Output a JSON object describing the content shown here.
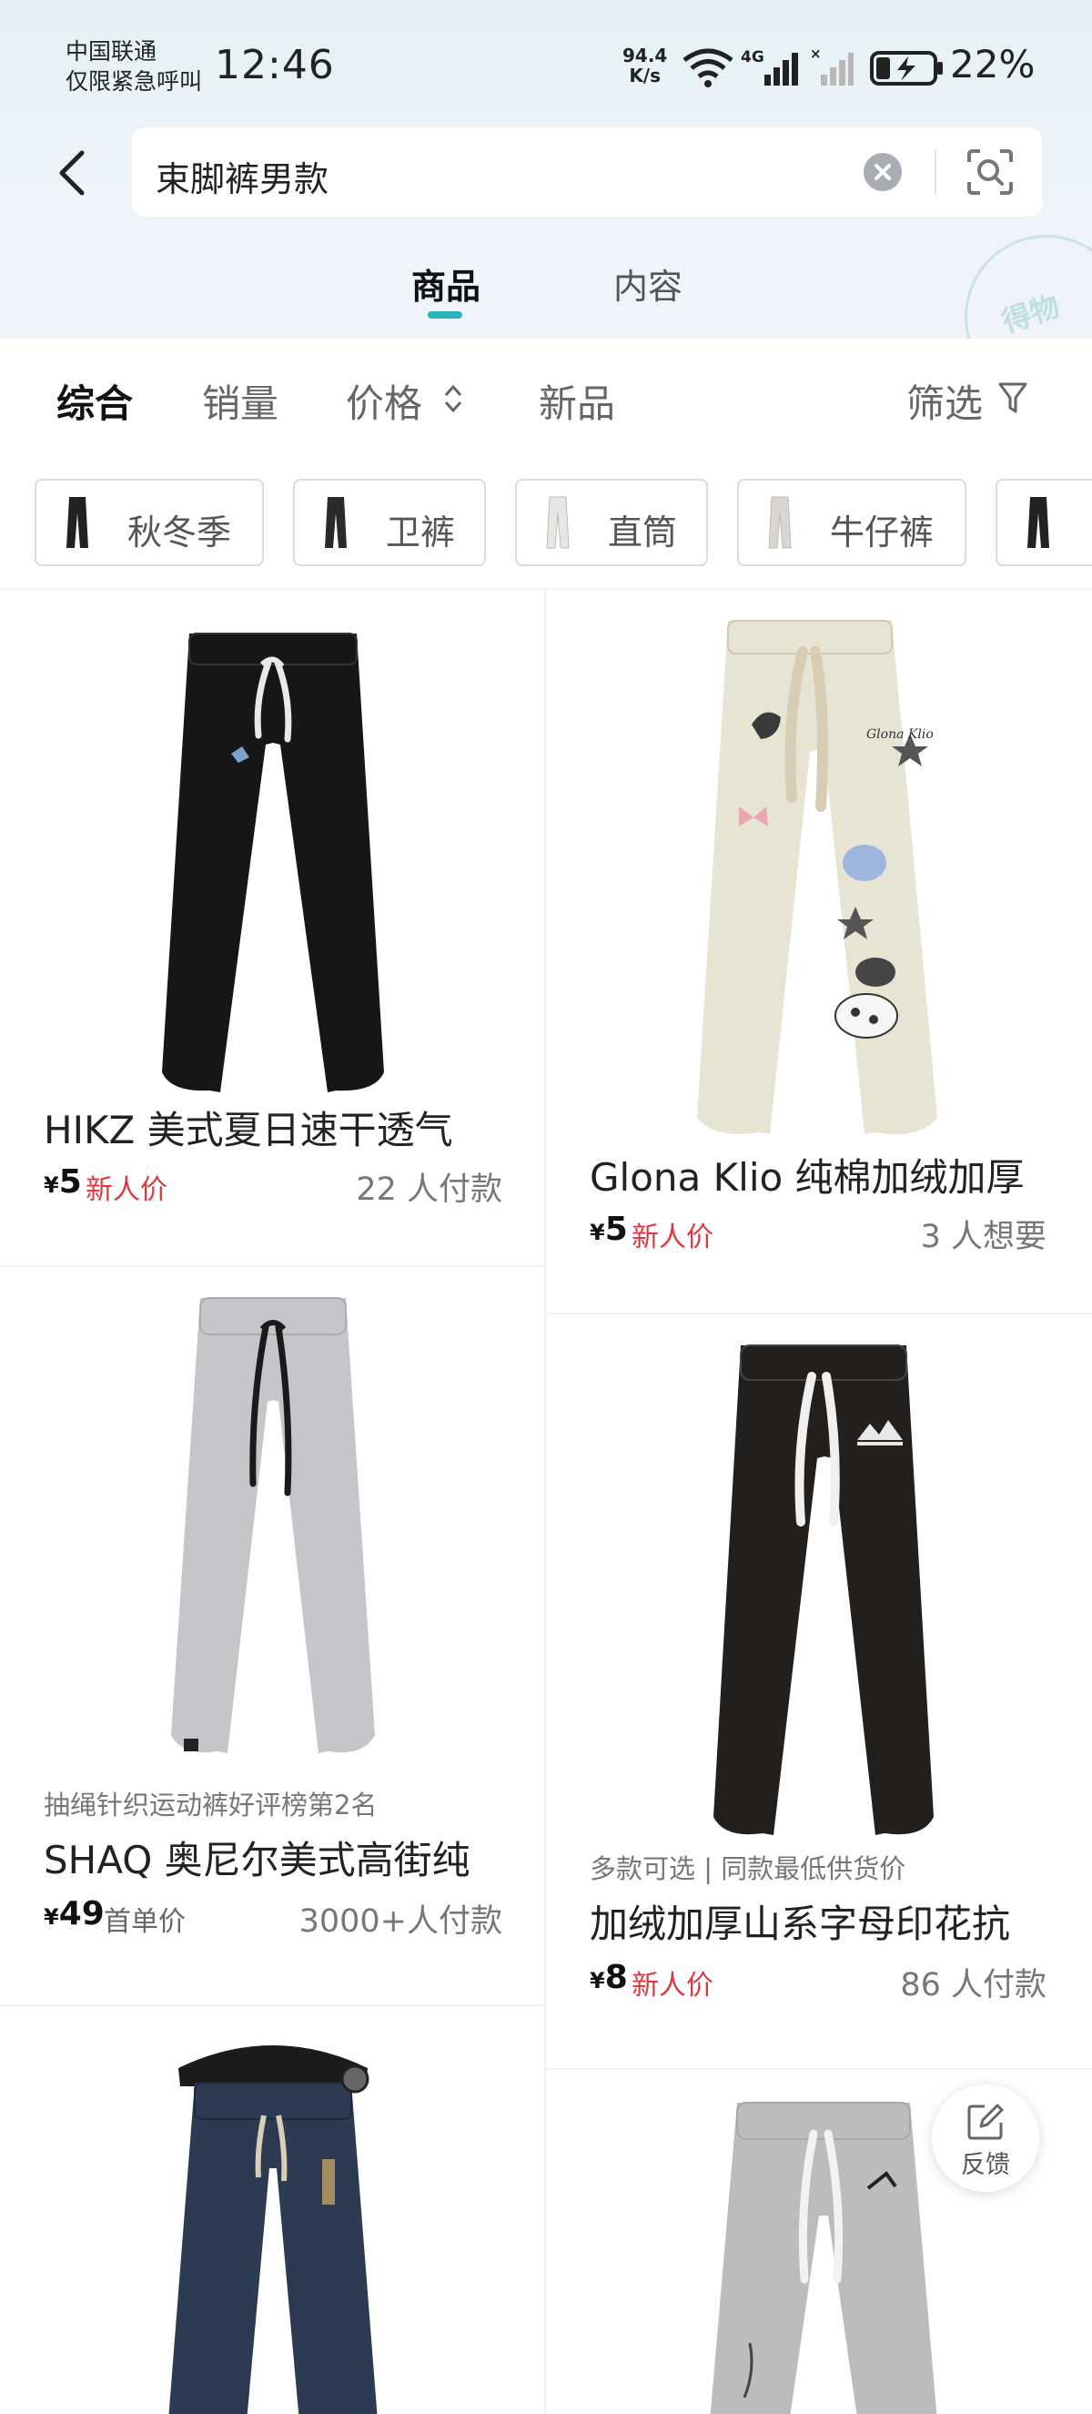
{
  "status_bar": {
    "carrier_line1": "中国联通",
    "carrier_line2": "仅限紧急呼叫",
    "time": "12:46",
    "net_speed_value": "94.4",
    "net_speed_unit": "K/s",
    "battery": "22%"
  },
  "search": {
    "query": "束脚裤男款"
  },
  "tabs": [
    {
      "label": "商品",
      "active": true
    },
    {
      "label": "内容",
      "active": false
    }
  ],
  "watermark": "得物",
  "sort_bar": {
    "items": [
      {
        "label": "综合",
        "active": true
      },
      {
        "label": "销量",
        "active": false
      },
      {
        "label": "价格",
        "active": false
      },
      {
        "label": "新品",
        "active": false
      }
    ],
    "filter_label": "筛选"
  },
  "chips": [
    {
      "label": "秋冬季",
      "thumb_color": "#222222"
    },
    {
      "label": "卫裤",
      "thumb_color": "#2a2a2a"
    },
    {
      "label": "直筒",
      "thumb_color": "#e8e6e0"
    },
    {
      "label": "牛仔裤",
      "thumb_color": "#d8d6cf"
    },
    {
      "label": "",
      "thumb_color": "#222222"
    }
  ],
  "products": [
    {
      "title": "HIKZ 美式夏日速干透气",
      "tag": "",
      "price_symbol": "¥",
      "price": "5",
      "price_label": "新人价",
      "count": "22 人付款",
      "pants_color": "#161616",
      "string_color": "#e9e9e9"
    },
    {
      "title": "Glona Klio 纯棉加绒加厚",
      "tag": "",
      "price_symbol": "¥",
      "price": "5",
      "price_label": "新人价",
      "count": "3 人想要",
      "pants_color": "#e8e4d4",
      "string_color": "#d8ccb4"
    },
    {
      "title": "SHAQ 奥尼尔美式高街纯",
      "tag": "抽绳针织运动裤好评榜第2名",
      "price_symbol": "¥",
      "price": "49",
      "price_label": "首单价",
      "count": "3000+人付款",
      "pants_color": "#c4c6ca",
      "string_color": "#1a1a1a"
    },
    {
      "title": "加绒加厚山系字母印花抗",
      "tag": "多款可选 | 同款最低供货价",
      "price_symbol": "¥",
      "price": "8",
      "price_label": "新人价",
      "count": "86 人付款",
      "pants_color": "#231f1c",
      "string_color": "#f0f0f0"
    },
    {
      "title": "",
      "tag": "",
      "pants_color": "#2c3a52",
      "string_color": "#d9cfb6"
    },
    {
      "title": "",
      "tag": "",
      "pants_color": "#bcbcbc",
      "string_color": "#f2f2f2"
    }
  ],
  "feedback": {
    "label": "反馈"
  }
}
